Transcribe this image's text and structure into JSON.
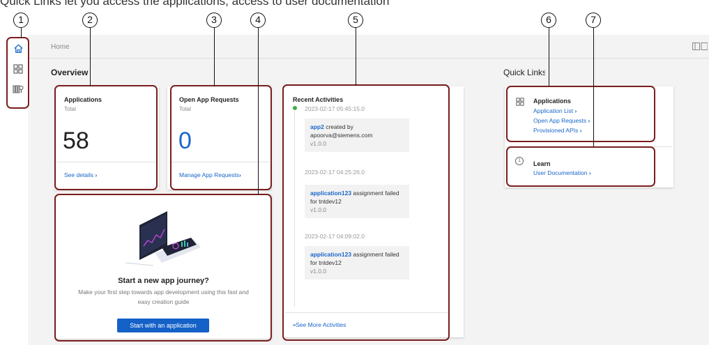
{
  "caption": "Quick Links let you access the applications, access to user documentation",
  "callouts": [
    "1",
    "2",
    "3",
    "4",
    "5",
    "6",
    "7"
  ],
  "breadcrumb": "Home",
  "overview": {
    "title": "Overview",
    "applications": {
      "title": "Applications",
      "sub": "Total",
      "count": "58",
      "link": "See details"
    },
    "open_requests": {
      "title": "Open App Requests",
      "sub": "Total",
      "count": "0",
      "link": "Manage App Requests"
    },
    "journey": {
      "title": "Start a new app journey?",
      "desc1": "Make your first step towards app development using this fast and",
      "desc2": "easy creation guide",
      "button": "Start with an application"
    }
  },
  "recent": {
    "title": "Recent Activities",
    "items": [
      {
        "time": "2023-02-17 05:45:15.0",
        "name": "app2",
        "text": " created by",
        "line2": "apoorva@siemens.com",
        "version": "v1.0.0"
      },
      {
        "time": "2023-02-17 04:25:26.0",
        "name": "application123",
        "text": " assignment failed",
        "line2": "for tntdev12",
        "version": "v1.0.0"
      },
      {
        "time": "2023-02-17 04:09:02.0",
        "name": "application123",
        "text": " assignment failed",
        "line2": "for tntdev12",
        "version": "v1.0.0"
      }
    ],
    "more": "See More Activities"
  },
  "quick_links": {
    "title": "Quick Links",
    "applications": {
      "title": "Applications",
      "links": [
        "Application List",
        "Open App Requests",
        "Provisioned APIs"
      ]
    },
    "learn": {
      "title": "Learn",
      "links": [
        "User Documentation"
      ]
    }
  },
  "colors": {
    "accent": "#1a66c9",
    "highlight": "#7a1d1d",
    "status_dot": "#3cb043"
  },
  "icons": [
    "home-icon",
    "grid-icon",
    "api-icon",
    "chevron-right-icon",
    "info-icon",
    "panel-icon"
  ]
}
